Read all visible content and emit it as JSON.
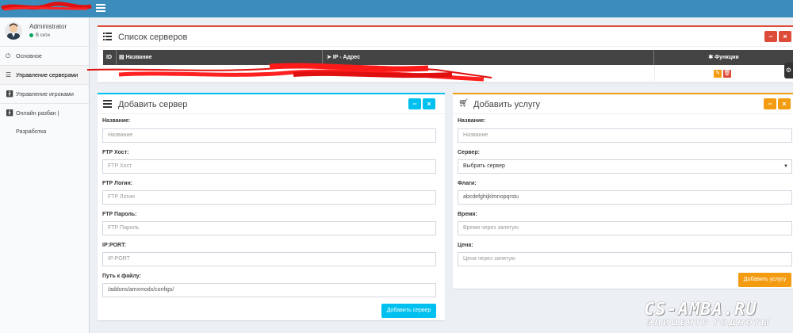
{
  "sidebar": {
    "user": {
      "name": "Administrator",
      "status": "В сети"
    },
    "items": [
      {
        "label": "Основное",
        "icon": "power-icon"
      },
      {
        "label": "Управление серверами",
        "icon": "server-list-icon"
      },
      {
        "label": "Управление игроками",
        "icon": "person-icon"
      },
      {
        "label": "Онлайн разбан | Разработка",
        "icon": "person-icon"
      }
    ]
  },
  "server_list": {
    "title": "Список серверов",
    "columns": [
      "ID",
      "Название",
      "IP - Адрес",
      "Функции"
    ]
  },
  "add_server": {
    "title": "Добавить сервер",
    "fields": [
      {
        "label": "Название:",
        "placeholder": "Название",
        "value": ""
      },
      {
        "label": "FTP Хост:",
        "placeholder": "FTP Хост",
        "value": ""
      },
      {
        "label": "FTP Логин:",
        "placeholder": "FTP Логин",
        "value": ""
      },
      {
        "label": "FTP Пароль:",
        "placeholder": "FTP Пароль",
        "value": ""
      },
      {
        "label": "IP:PORT:",
        "placeholder": "IP:PORT",
        "value": ""
      },
      {
        "label": "Путь к файлу:",
        "placeholder": "",
        "value": "/addons/amxmodx/configs/"
      }
    ],
    "submit_label": "Добавить сервер"
  },
  "add_service": {
    "title": "Добавить услугу",
    "fields": [
      {
        "label": "Название:",
        "placeholder": "Название"
      },
      {
        "label": "Сервер:",
        "selected": "Выбрать сервер"
      },
      {
        "label": "Флаги:",
        "placeholder": "abcdefghijklmnopqrstu"
      },
      {
        "label": "Время:",
        "placeholder": "Время через запятую"
      },
      {
        "label": "Цена:",
        "placeholder": "Цена через запятую"
      }
    ],
    "submit_label": "Добавить услугу"
  },
  "watermark": {
    "line1": "CS-AMBA.RU",
    "line2": "ЭПИЦЕНТР ГОДНОТЫ"
  },
  "colors": {
    "topbar": "#3c8dbc",
    "danger": "#dd4b39",
    "info": "#00c0ef",
    "warning": "#f39c12"
  }
}
